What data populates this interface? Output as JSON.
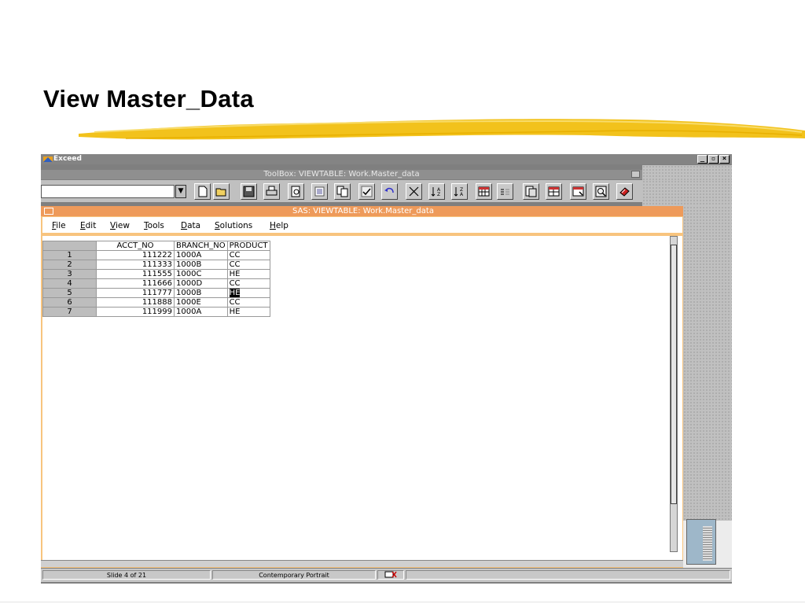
{
  "slide": {
    "title": "View Master_Data"
  },
  "exceed": {
    "title": "Exceed",
    "controls": [
      "_",
      "▫",
      "×"
    ]
  },
  "toolbox": {
    "title": "ToolBox: VIEWTABLE: Work.Master_data",
    "command_value": "",
    "buttons": [
      "new-icon",
      "open-folder-icon",
      "save-icon",
      "print-icon",
      "print-preview-icon",
      "cut-icon",
      "copy-icon",
      "check-icon",
      "undo-icon",
      "delete-icon",
      "sort-ascending-icon",
      "sort-descending-icon",
      "table-icon",
      "list-icon",
      "form-icon",
      "columns-icon",
      "view-icon",
      "zoom-icon",
      "help-book-icon"
    ]
  },
  "viewtable": {
    "title": "SAS: VIEWTABLE: Work.Master_data",
    "menu": [
      "File",
      "Edit",
      "View",
      "Tools",
      "Data",
      "Solutions",
      "Help"
    ],
    "columns": [
      "ACCT_NO",
      "BRANCH_NO",
      "PRODUCT"
    ],
    "rows": [
      {
        "n": "1",
        "acct": "111222",
        "branch": "1000A",
        "product": "CC"
      },
      {
        "n": "2",
        "acct": "111333",
        "branch": "1000B",
        "product": "CC"
      },
      {
        "n": "3",
        "acct": "111555",
        "branch": "1000C",
        "product": "HE"
      },
      {
        "n": "4",
        "acct": "111666",
        "branch": "1000D",
        "product": "CC"
      },
      {
        "n": "5",
        "acct": "111777",
        "branch": "1000B",
        "product": "HE"
      },
      {
        "n": "6",
        "acct": "111888",
        "branch": "1000E",
        "product": "CC"
      },
      {
        "n": "7",
        "acct": "111999",
        "branch": "1000A",
        "product": "HE"
      }
    ],
    "selected_cell": "HE"
  },
  "statusbar": {
    "slide_info": "Slide 4 of 21",
    "design": "Contemporary Portrait"
  },
  "colors": {
    "window_title": "#ee9a5a",
    "window_frame": "#f8c47e",
    "brush": "#f2c21c"
  }
}
